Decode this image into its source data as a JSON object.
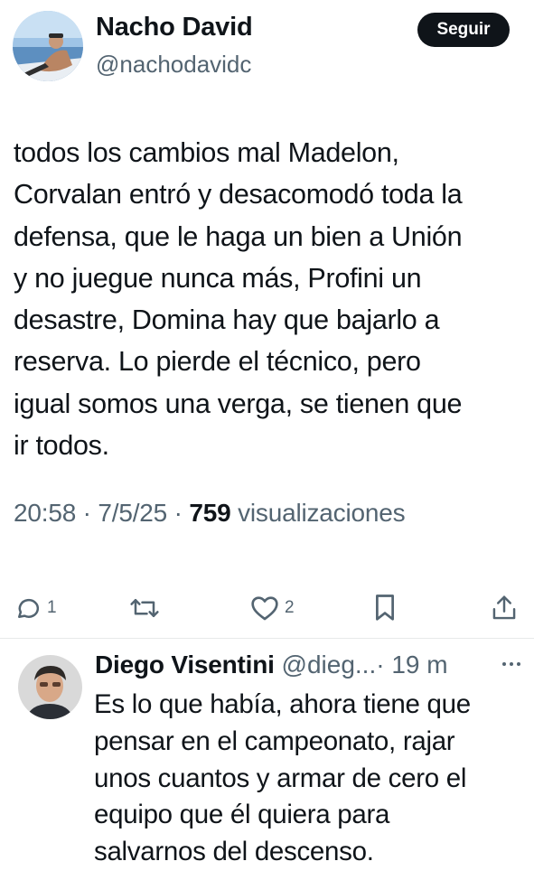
{
  "tweet": {
    "author_name": "Nacho David",
    "author_handle": "@nachodavidc",
    "follow_label": "Seguir",
    "text": "todos los cambios mal Madelon,\nCorvalan entró y desacomodó toda la\ndefensa, que le haga un bien a Unión\ny no juegue nunca más, Profini un\ndesastre, Domina hay que bajarlo a\nreserva. Lo pierde el técnico, pero\nigual somos una verga, se tienen que\nir todos.",
    "time": "20:58",
    "date": "7/5/25",
    "separator": "·",
    "views_count": "759",
    "views_label": "visualizaciones",
    "actions": {
      "reply": {
        "icon": "reply-icon",
        "count": "1"
      },
      "retweet": {
        "icon": "retweet-icon",
        "count": ""
      },
      "like": {
        "icon": "heart-icon",
        "count": "2"
      },
      "bookmark": {
        "icon": "bookmark-icon",
        "count": ""
      },
      "share": {
        "icon": "share-icon",
        "count": ""
      }
    }
  },
  "reply": {
    "author_name": "Diego Visentini",
    "author_handle": "@dieg...",
    "separator": "·",
    "time": "19 m",
    "more_icon": "more-icon",
    "text": "Es lo que había, ahora tiene que\npensar en el campeonato, rajar\nunos cuantos y armar de cero el\nequipo que él quiera para\nsalvarnos del descenso."
  },
  "colors": {
    "text_primary": "#0f1419",
    "text_secondary": "#536471",
    "follow_bg": "#0f1419",
    "divider": "#e7e9ea"
  }
}
